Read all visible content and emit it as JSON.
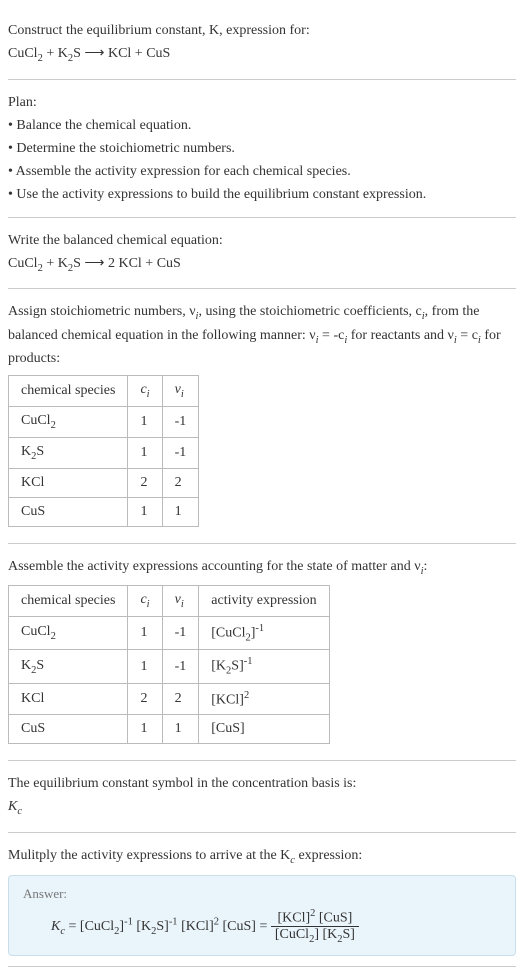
{
  "header": {
    "prompt": "Construct the equilibrium constant, K, expression for:",
    "equation_lhs1": "CuCl",
    "equation_lhs1_sub": "2",
    "equation_plus1": " + K",
    "equation_lhs2_sub": "2",
    "equation_lhs2_tail": "S ",
    "arrow": "⟶",
    "equation_rhs": " KCl + CuS"
  },
  "plan": {
    "title": "Plan:",
    "item1": "• Balance the chemical equation.",
    "item2": "• Determine the stoichiometric numbers.",
    "item3": "• Assemble the activity expression for each chemical species.",
    "item4": "• Use the activity expressions to build the equilibrium constant expression."
  },
  "balanced": {
    "title": "Write the balanced chemical equation:",
    "eq_part1": "CuCl",
    "eq_sub1": "2",
    "eq_part2": " + K",
    "eq_sub2": "2",
    "eq_part3": "S ",
    "arrow": "⟶",
    "eq_part4": " 2 KCl + CuS"
  },
  "assign_nu": {
    "text1": "Assign stoichiometric numbers, ν",
    "sub1": "i",
    "text2": ", using the stoichiometric coefficients, c",
    "sub2": "i",
    "text3": ", from the balanced chemical equation in the following manner: ν",
    "sub3": "i",
    "text4": " = -c",
    "sub4": "i",
    "text5": " for reactants and ν",
    "sub5": "i",
    "text6": " = c",
    "sub6": "i",
    "text7": " for products:"
  },
  "table1": {
    "h1": "chemical species",
    "h2_main": "c",
    "h2_sub": "i",
    "h3_main": "ν",
    "h3_sub": "i",
    "rows": [
      {
        "species_main": "CuCl",
        "species_sub": "2",
        "c": "1",
        "nu": "-1"
      },
      {
        "species_main": "K",
        "species_sub": "2",
        "species_tail": "S",
        "c": "1",
        "nu": "-1"
      },
      {
        "species_main": "KCl",
        "c": "2",
        "nu": "2"
      },
      {
        "species_main": "CuS",
        "c": "1",
        "nu": "1"
      }
    ]
  },
  "assemble": {
    "text1": "Assemble the activity expressions accounting for the state of matter and ν",
    "sub1": "i",
    "text2": ":"
  },
  "table2": {
    "h1": "chemical species",
    "h2_main": "c",
    "h2_sub": "i",
    "h3_main": "ν",
    "h3_sub": "i",
    "h4": "activity expression",
    "rows": [
      {
        "species_main": "CuCl",
        "species_sub": "2",
        "c": "1",
        "nu": "-1",
        "act_pre": "[CuCl",
        "act_sub": "2",
        "act_post": "]",
        "act_exp": "-1"
      },
      {
        "species_main": "K",
        "species_sub": "2",
        "species_tail": "S",
        "c": "1",
        "nu": "-1",
        "act_pre": "[K",
        "act_sub": "2",
        "act_post": "S]",
        "act_exp": "-1"
      },
      {
        "species_main": "KCl",
        "c": "2",
        "nu": "2",
        "act_pre": "[KCl]",
        "act_exp": "2"
      },
      {
        "species_main": "CuS",
        "c": "1",
        "nu": "1",
        "act_pre": "[CuS]"
      }
    ]
  },
  "symbol_section": {
    "text": "The equilibrium constant symbol in the concentration basis is:",
    "symbol_main": "K",
    "symbol_sub": "c"
  },
  "multiply": {
    "text1": "Mulitply the activity expressions to arrive at the K",
    "sub1": "c",
    "text2": " expression:"
  },
  "answer": {
    "label": "Answer:",
    "kc_main": "K",
    "kc_sub": "c",
    "eq_sign1": " = ",
    "term1_pre": "[CuCl",
    "term1_sub": "2",
    "term1_post": "]",
    "term1_exp": "-1",
    "term2_pre": " [K",
    "term2_sub": "2",
    "term2_post": "S]",
    "term2_exp": "-1",
    "term3_pre": " [KCl]",
    "term3_exp": "2",
    "term4": " [CuS]",
    "eq_sign2": " = ",
    "frac_num_pre": "[KCl]",
    "frac_num_exp": "2",
    "frac_num_post": " [CuS]",
    "frac_den_pre": "[CuCl",
    "frac_den_sub1": "2",
    "frac_den_mid": "] [K",
    "frac_den_sub2": "2",
    "frac_den_post": "S]"
  }
}
